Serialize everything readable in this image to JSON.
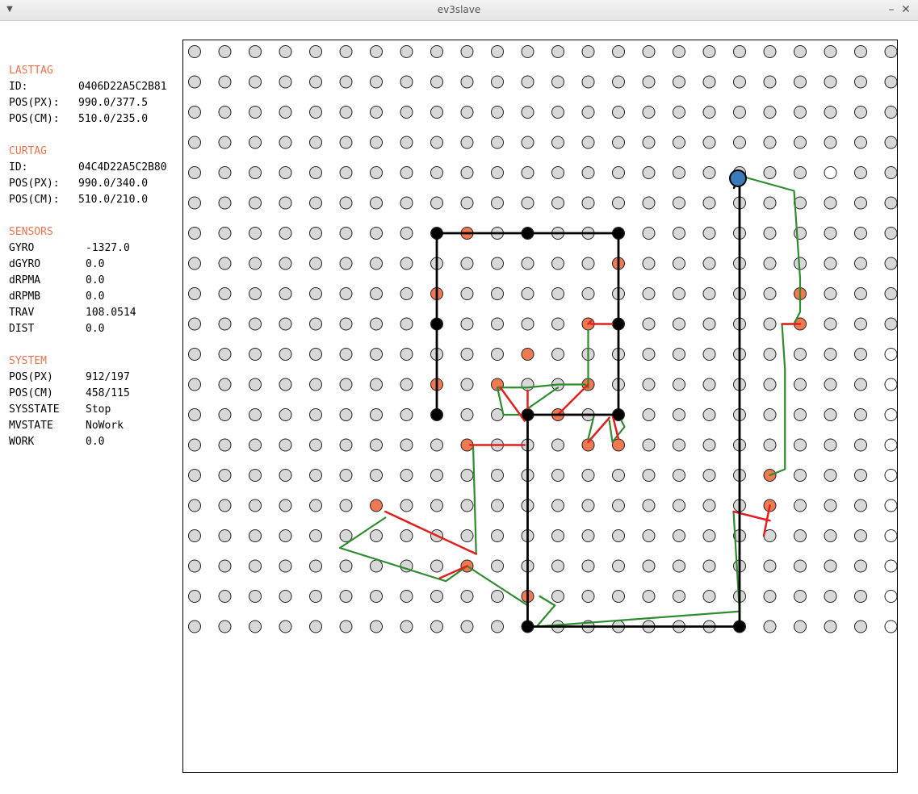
{
  "window": {
    "title": "ev3slave"
  },
  "panel": {
    "lasttag": {
      "header": "LASTTAG",
      "rows": [
        {
          "label": "ID:",
          "value": "0406D22A5C2B81"
        },
        {
          "label": "POS(PX):",
          "value": "990.0/377.5"
        },
        {
          "label": "POS(CM):",
          "value": "510.0/235.0"
        }
      ]
    },
    "curtag": {
      "header": "CURTAG",
      "rows": [
        {
          "label": "ID:",
          "value": "04C4D22A5C2B80"
        },
        {
          "label": "POS(PX):",
          "value": "990.0/340.0"
        },
        {
          "label": "POS(CM):",
          "value": "510.0/210.0"
        }
      ]
    },
    "sensors": {
      "header": "SENSORS",
      "rows": [
        {
          "label": "GYRO",
          "value": "-1327.0"
        },
        {
          "label": "dGYRO",
          "value": "0.0"
        },
        {
          "label": "dRPMA",
          "value": "0.0"
        },
        {
          "label": "dRPMB",
          "value": "0.0"
        },
        {
          "label": "TRAV",
          "value": "108.0514"
        },
        {
          "label": "DIST",
          "value": "0.0"
        }
      ]
    },
    "system": {
      "header": "SYSTEM",
      "rows": [
        {
          "label": "POS(PX)",
          "value": "912/197"
        },
        {
          "label": "POS(CM)",
          "value": "458/115"
        },
        {
          "label": "SYSSTATE",
          "value": "Stop"
        },
        {
          "label": "MVSTATE",
          "value": "NoWork"
        },
        {
          "label": "WORK",
          "value": "0.0"
        }
      ]
    }
  },
  "map": {
    "colors": {
      "grid_dot": "#d8d8d8",
      "orange_tag": "#ef7a52",
      "path_black": "#000000",
      "path_red": "#e02020",
      "path_green": "#2e8b2e",
      "robot": "#3a7ab8"
    },
    "grid": {
      "cols": 24,
      "rows": 20
    },
    "white_tags": [
      [
        21,
        4
      ],
      [
        23,
        10
      ],
      [
        23,
        11
      ],
      [
        23,
        12
      ],
      [
        23,
        13
      ],
      [
        23,
        14
      ],
      [
        23,
        15
      ],
      [
        23,
        16
      ],
      [
        23,
        17
      ],
      [
        23,
        18
      ],
      [
        23,
        19
      ]
    ],
    "orange_tags": [
      [
        9,
        6
      ],
      [
        14,
        7
      ],
      [
        8,
        8
      ],
      [
        20,
        8
      ],
      [
        13,
        9
      ],
      [
        20,
        9
      ],
      [
        11,
        10
      ],
      [
        8,
        11
      ],
      [
        10,
        11
      ],
      [
        13,
        11
      ],
      [
        12,
        12
      ],
      [
        13,
        13
      ],
      [
        14,
        13
      ],
      [
        9,
        13
      ],
      [
        19,
        14
      ],
      [
        6,
        15
      ],
      [
        19,
        15
      ],
      [
        9,
        17
      ],
      [
        11,
        18
      ]
    ],
    "black_nodes": [
      [
        8,
        6
      ],
      [
        11,
        6
      ],
      [
        14,
        6
      ],
      [
        8,
        9
      ],
      [
        14,
        9
      ],
      [
        8,
        12
      ],
      [
        11,
        12
      ],
      [
        14,
        12
      ],
      [
        11,
        19
      ],
      [
        18,
        19
      ]
    ],
    "robot_cell": [
      18,
      4
    ],
    "black_path": [
      [
        [
          8,
          12
        ],
        [
          8,
          9
        ],
        [
          8,
          6
        ],
        [
          11,
          6
        ],
        [
          14,
          6
        ],
        [
          14,
          9
        ],
        [
          14,
          12
        ],
        [
          11,
          12
        ],
        [
          11,
          19
        ],
        [
          18,
          19
        ],
        [
          18,
          4
        ]
      ]
    ],
    "red_segments": [
      [
        [
          10.9,
          13.0
        ],
        [
          9.1,
          13.0
        ]
      ],
      [
        [
          6.3,
          15.2
        ],
        [
          9.3,
          16.6
        ]
      ],
      [
        [
          9.0,
          17.0
        ],
        [
          8.1,
          17.4
        ]
      ],
      [
        [
          10.9,
          12.2
        ],
        [
          10.1,
          11.1
        ]
      ],
      [
        [
          11.0,
          11.2
        ],
        [
          11.0,
          12.0
        ]
      ],
      [
        [
          13.0,
          9.0
        ],
        [
          13.1,
          8.9
        ]
      ],
      [
        [
          13.1,
          9.0
        ],
        [
          14.0,
          9.0
        ]
      ],
      [
        [
          12.0,
          12.0
        ],
        [
          13.0,
          11.0
        ]
      ],
      [
        [
          12.0,
          12.0
        ],
        [
          13.2,
          12.0
        ]
      ],
      [
        [
          13.0,
          12.9
        ],
        [
          13.7,
          12.1
        ]
      ],
      [
        [
          13.8,
          12.0
        ],
        [
          14.0,
          12.8
        ]
      ],
      [
        [
          19.4,
          9.0
        ],
        [
          20.0,
          9.0
        ]
      ],
      [
        [
          17.8,
          15.2
        ],
        [
          19.0,
          15.5
        ]
      ],
      [
        [
          18.8,
          16.0
        ],
        [
          19.0,
          15.0
        ]
      ]
    ],
    "green_paths": [
      [
        [
          18.0,
          4.1
        ],
        [
          19.8,
          4.6
        ],
        [
          20.0,
          7.5
        ],
        [
          20.0,
          8.6
        ],
        [
          19.8,
          9.0
        ],
        [
          19.4,
          9.0
        ],
        [
          19.5,
          10.5
        ],
        [
          19.5,
          12.5
        ],
        [
          19.5,
          13.8
        ],
        [
          19.0,
          14.0
        ]
      ],
      [
        [
          17.8,
          15.2
        ],
        [
          18.0,
          18.5
        ],
        [
          11.3,
          19.0
        ],
        [
          11.9,
          18.3
        ],
        [
          11.4,
          18.0
        ]
      ],
      [
        [
          11.0,
          18.3
        ],
        [
          9.0,
          17.0
        ],
        [
          8.3,
          17.5
        ],
        [
          4.8,
          16.4
        ],
        [
          6.3,
          15.4
        ]
      ],
      [
        [
          9.3,
          16.6
        ],
        [
          9.2,
          13.0
        ]
      ],
      [
        [
          11.0,
          12.0
        ],
        [
          10.2,
          12.0
        ],
        [
          10.0,
          11.1
        ],
        [
          11.0,
          11.1
        ],
        [
          12.0,
          11.0
        ],
        [
          12.9,
          11.0
        ],
        [
          13.0,
          11.1
        ]
      ],
      [
        [
          11.0,
          11.8
        ],
        [
          12.0,
          11.1
        ]
      ],
      [
        [
          13.0,
          11.1
        ],
        [
          13.0,
          9.2
        ]
      ],
      [
        [
          13.0,
          12.8
        ],
        [
          13.2,
          12.0
        ],
        [
          14.0,
          12.0
        ],
        [
          14.2,
          12.4
        ],
        [
          13.8,
          12.9
        ],
        [
          13.7,
          12.2
        ]
      ]
    ]
  }
}
